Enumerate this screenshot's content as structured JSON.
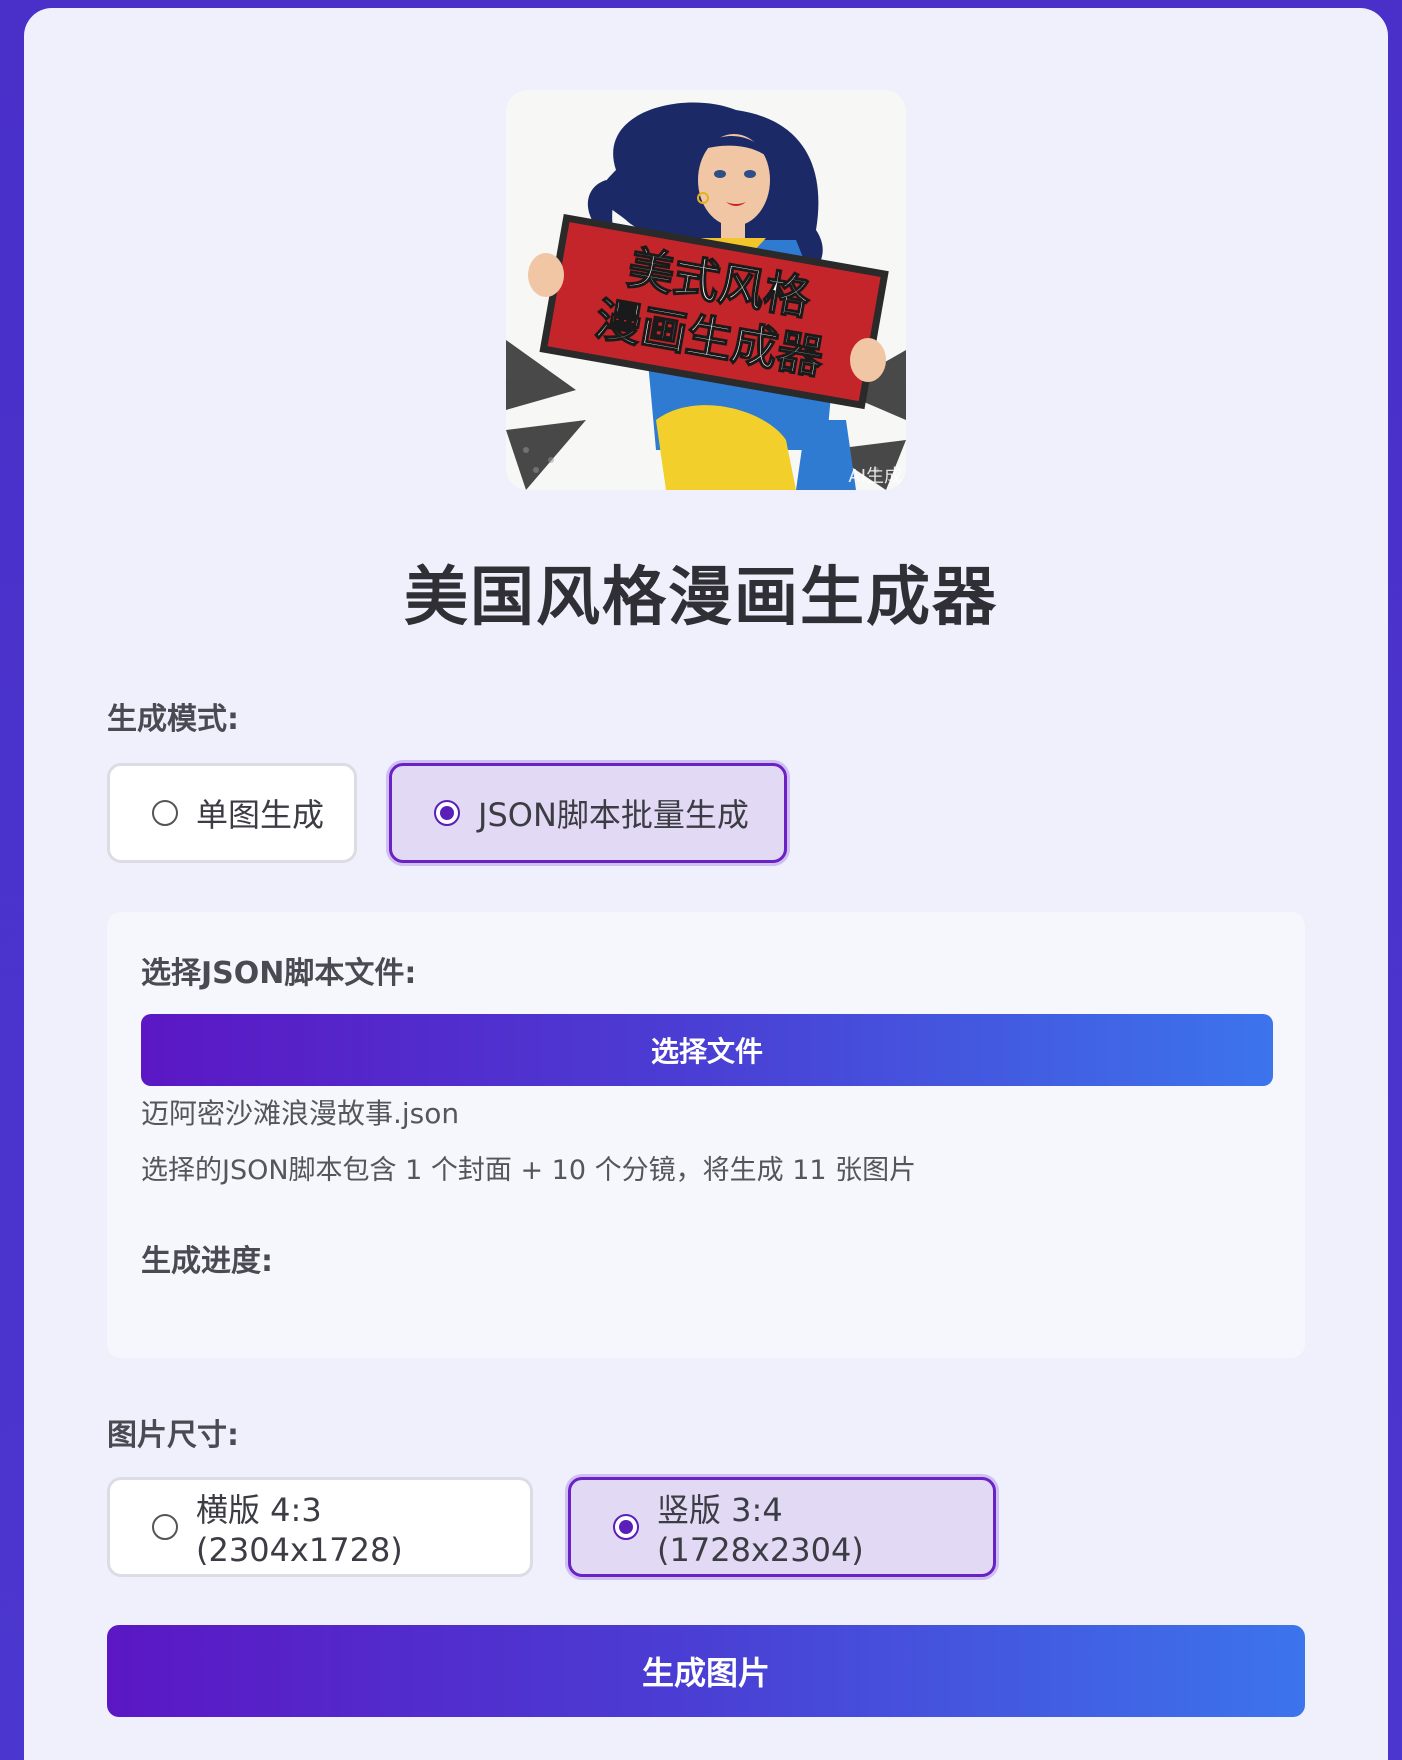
{
  "hero": {
    "sign_line1": "美式风格",
    "sign_line2": "漫画生成器",
    "ai_tag": "AI生成"
  },
  "title": "美国风格漫画生成器",
  "mode": {
    "label": "生成模式:",
    "options": [
      "单图生成",
      "JSON脚本批量生成"
    ],
    "selected": "JSON脚本批量生成"
  },
  "json_panel": {
    "label": "选择JSON脚本文件:",
    "button": "选择文件",
    "file_name": "迈阿密沙滩浪漫故事.json",
    "info": "选择的JSON脚本包含 1 个封面 + 10 个分镜，将生成 11 张图片",
    "progress_label": "生成进度:"
  },
  "size": {
    "label": "图片尺寸:",
    "options": [
      "横版 4:3 (2304x1728)",
      "竖版 3:4 (1728x2304)"
    ],
    "selected": "竖版 3:4 (1728x2304)"
  },
  "generate_button": "生成图片",
  "colors": {
    "accent": "#5b17c4",
    "gradient_end": "#3c74ec",
    "selected_bg": "#e2daf4",
    "page_bg": "#eff0fb"
  }
}
